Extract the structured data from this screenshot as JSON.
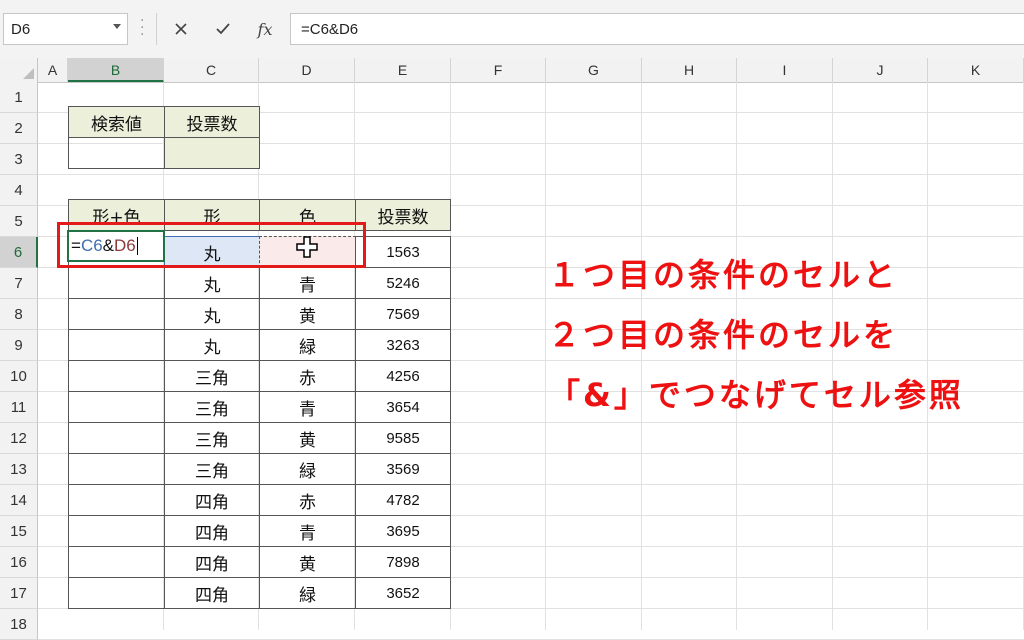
{
  "formula_bar": {
    "name_box": "D6",
    "cancel_icon": "x-icon",
    "enter_icon": "check-icon",
    "function_label": "fx",
    "formula": "=C6&D6"
  },
  "columns": [
    "A",
    "B",
    "C",
    "D",
    "E",
    "F",
    "G",
    "H",
    "I",
    "J",
    "K"
  ],
  "rows": [
    "1",
    "2",
    "3",
    "4",
    "5",
    "6",
    "7",
    "8",
    "9",
    "10",
    "11",
    "12",
    "13",
    "14",
    "15",
    "16",
    "17",
    "18"
  ],
  "lookup_table": {
    "header_search": "検索値",
    "header_votes": "投票数",
    "search_value": "",
    "votes_value": ""
  },
  "data_table": {
    "headers": [
      "形+色",
      "形",
      "色",
      "投票数"
    ],
    "editing_formula": {
      "prefix": "=",
      "ref1": "C6",
      "amp": "&",
      "ref2": "D6"
    },
    "rows": [
      {
        "shape": "丸",
        "color": "",
        "votes": "1563"
      },
      {
        "shape": "丸",
        "color": "青",
        "votes": "5246"
      },
      {
        "shape": "丸",
        "color": "黄",
        "votes": "7569"
      },
      {
        "shape": "丸",
        "color": "緑",
        "votes": "3263"
      },
      {
        "shape": "三角",
        "color": "赤",
        "votes": "4256"
      },
      {
        "shape": "三角",
        "color": "青",
        "votes": "3654"
      },
      {
        "shape": "三角",
        "color": "黄",
        "votes": "9585"
      },
      {
        "shape": "三角",
        "color": "緑",
        "votes": "3569"
      },
      {
        "shape": "四角",
        "color": "赤",
        "votes": "4782"
      },
      {
        "shape": "四角",
        "color": "青",
        "votes": "3695"
      },
      {
        "shape": "四角",
        "color": "黄",
        "votes": "7898"
      },
      {
        "shape": "四角",
        "color": "緑",
        "votes": "3652"
      }
    ]
  },
  "annotation": {
    "line1": "１つ目の条件のセルと",
    "line2": "２つ目の条件のセルを",
    "line3": "「&」でつなげてセル参照",
    "color": "#ee1111"
  },
  "colors": {
    "header_fill": "#ecefd9",
    "excel_green": "#217346",
    "highlight_box": "#e31a1a"
  }
}
